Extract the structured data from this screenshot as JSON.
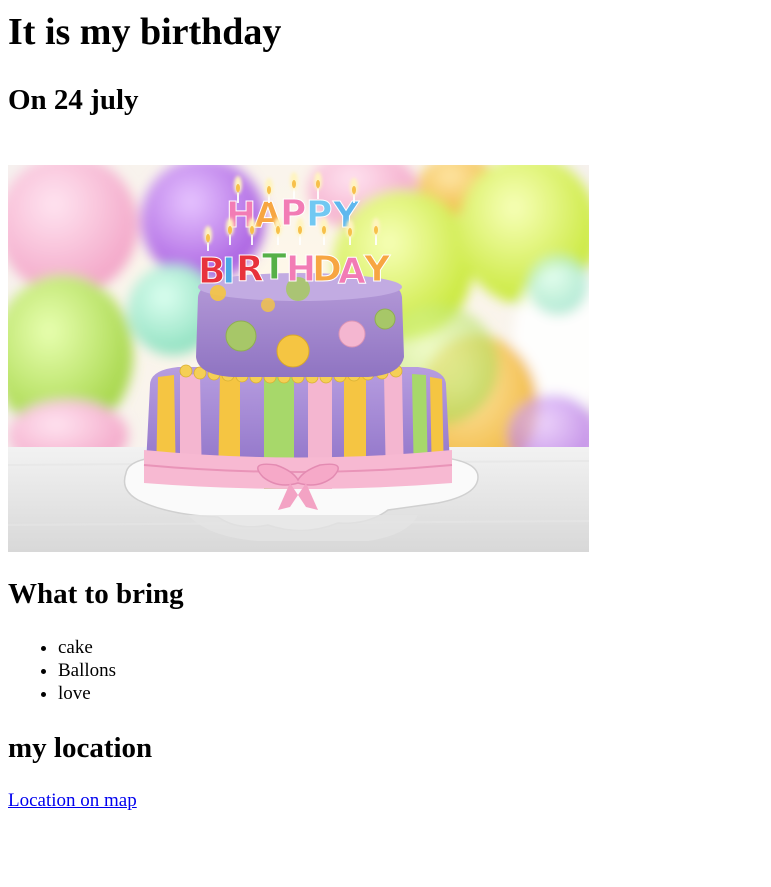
{
  "header": {
    "title": "It is my birthday",
    "date_line": "On 24 july"
  },
  "hero_image": {
    "icon": "birthday-cake-photo",
    "candle_letters": [
      "H",
      "A",
      "P",
      "P",
      "Y",
      "B",
      "I",
      "R",
      "T",
      "H",
      "D",
      "A",
      "Y"
    ]
  },
  "bring": {
    "title": "What to bring",
    "items": [
      "cake",
      "Ballons",
      "love"
    ]
  },
  "location": {
    "title": "my location",
    "link_label": "Location on map"
  },
  "colors": {
    "link": "#0000ee",
    "text": "#000000"
  }
}
